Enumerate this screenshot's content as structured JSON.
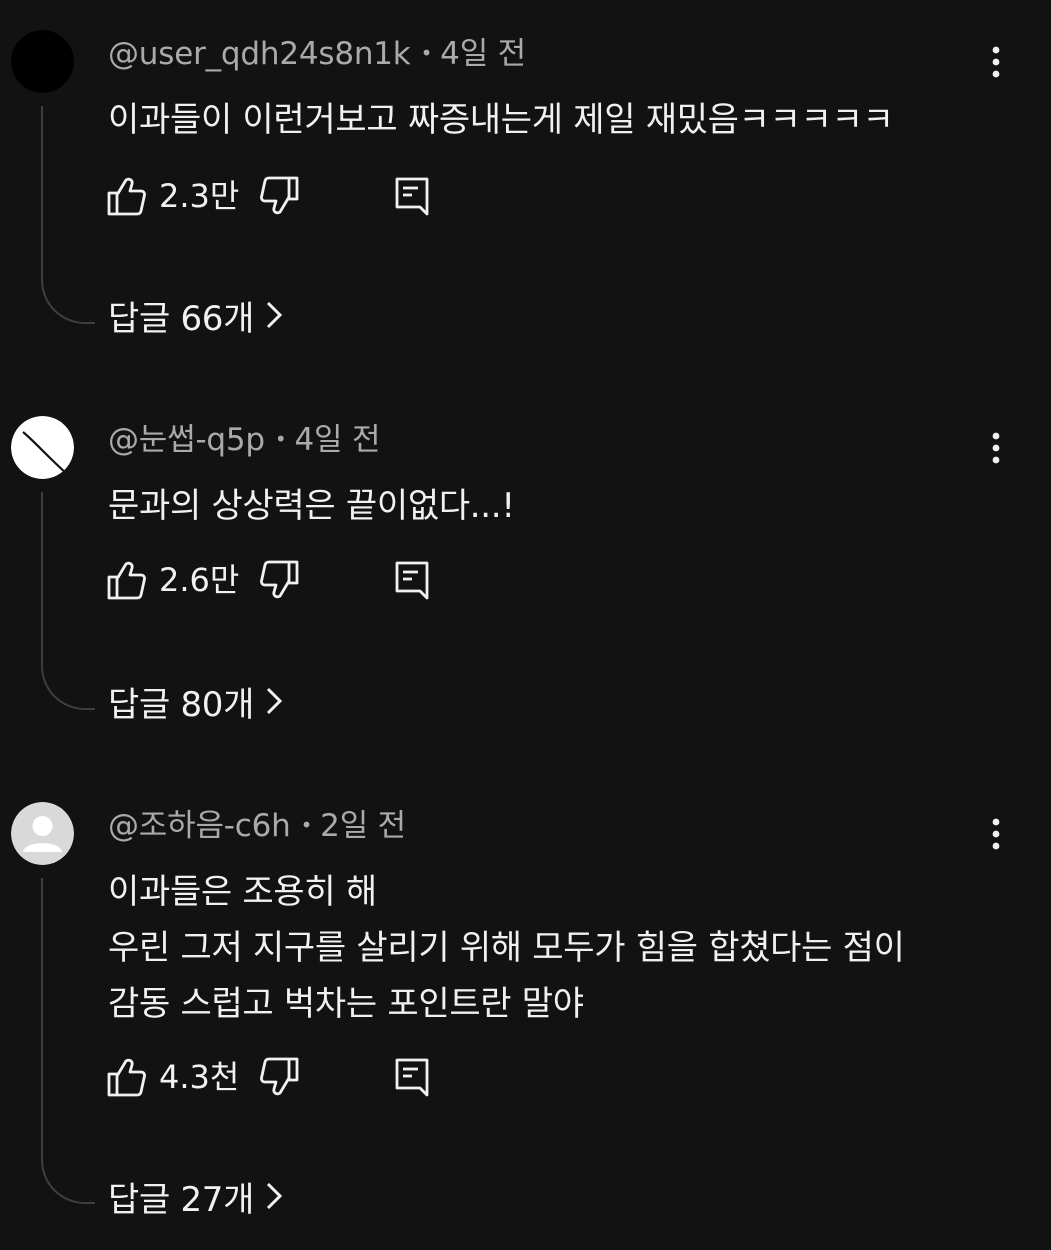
{
  "comments": [
    {
      "handle": "@user_qdh24s8n1k",
      "time": "4일 전",
      "lines": [
        "이과들이 이런거보고 짜증내는게 제일 재밌음ㅋㅋㅋㅋㅋ"
      ],
      "likes": "2.3만",
      "replies": "답글 66개",
      "avatar": "black-circle"
    },
    {
      "handle": "@눈썹-q5p",
      "time": "4일 전",
      "lines": [
        "문과의 상상력은 끝이없다...!"
      ],
      "likes": "2.6만",
      "replies": "답글 80개",
      "avatar": "white-circle-slash"
    },
    {
      "handle": "@조하음-c6h",
      "time": "2일 전",
      "lines": [
        "이과들은 조용히 해",
        "우린 그저 지구를 살리기 위해 모두가 힘을 합쳤다는 점이",
        "감동 스럽고 벅차는 포인트란 말야"
      ],
      "likes": "4.3천",
      "replies": "답글 27개",
      "avatar": "default-person"
    }
  ],
  "separator": "•",
  "icons": {
    "like": "thumb-up-icon",
    "dislike": "thumb-down-icon",
    "reply": "comment-reply-icon",
    "more": "more-vertical-icon",
    "chevron": "chevron-right-icon"
  },
  "colors": {
    "background": "#121212",
    "text": "#f1f1f1",
    "secondary_text": "#aaaaaa",
    "thread_line": "#3e3e3e"
  }
}
